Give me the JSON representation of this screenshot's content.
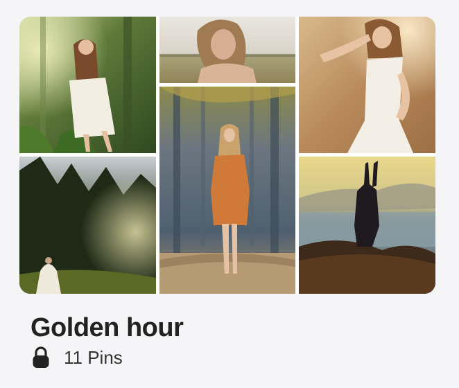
{
  "board": {
    "title": "Golden hour",
    "pins_label": "11 Pins",
    "privacy_icon": "lock-icon",
    "cover_photos": [
      {
        "position": "top-left"
      },
      {
        "position": "top-middle"
      },
      {
        "position": "top-right"
      },
      {
        "position": "bottom-left"
      },
      {
        "position": "center-tall"
      },
      {
        "position": "bottom-right"
      }
    ]
  },
  "colors": {
    "background": "#f5f5f7",
    "title": "#222222",
    "meta_text": "#333333"
  }
}
